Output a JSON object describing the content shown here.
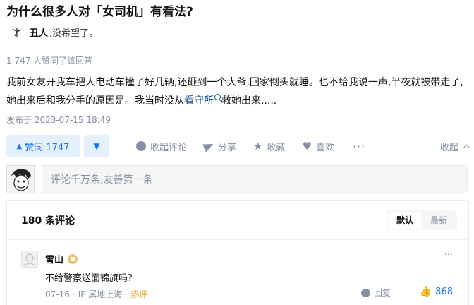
{
  "question": {
    "title": "为什么很多人对「女司机」有看法?"
  },
  "author": {
    "avatar_icon": "windmill-icon",
    "name": "丑人",
    "bio": ",没希望了。"
  },
  "answer": {
    "agree_count_text": "1,747 人赞同了该回答",
    "content_before_link": "我前女友开我车把人电动车撞了好几辆,还砸到一个大爷,回家倒头就睡。也不给我说一声,半夜就被带走了,她出来后和我分手的原因是。我当时没从",
    "link_text": "看守所",
    "link_icon": "search-icon",
    "content_after_link": "救她出来.....",
    "published": "发布于 2023-07-15 18:49"
  },
  "actions": {
    "vote_up": "赞同 1747",
    "vote_up_icon": "▲",
    "vote_down_icon": "▼",
    "comment": "收起评论",
    "share": "分享",
    "favorite": "收藏",
    "like": "喜欢",
    "more": "···",
    "collapse": "收起"
  },
  "comment_input": {
    "placeholder": "评论千万条,友善第一条"
  },
  "comments": {
    "count_text": "180 条评论",
    "sort": {
      "default": "默认",
      "latest": "最新",
      "active": "default"
    },
    "items": [
      {
        "name": "雪山",
        "badge_icon": "creator-badge-icon",
        "text": "不给警察送面锦旗吗?",
        "date": "07-16",
        "location": "IP 属地上海",
        "hot": "热评",
        "reply": "回复",
        "likes": "868",
        "more": "···"
      }
    ]
  },
  "colors": {
    "accent": "#1772f6",
    "accent_bg": "#e5f0fe",
    "muted": "#8590a6",
    "link": "#175199",
    "hot": "#f0a020"
  }
}
